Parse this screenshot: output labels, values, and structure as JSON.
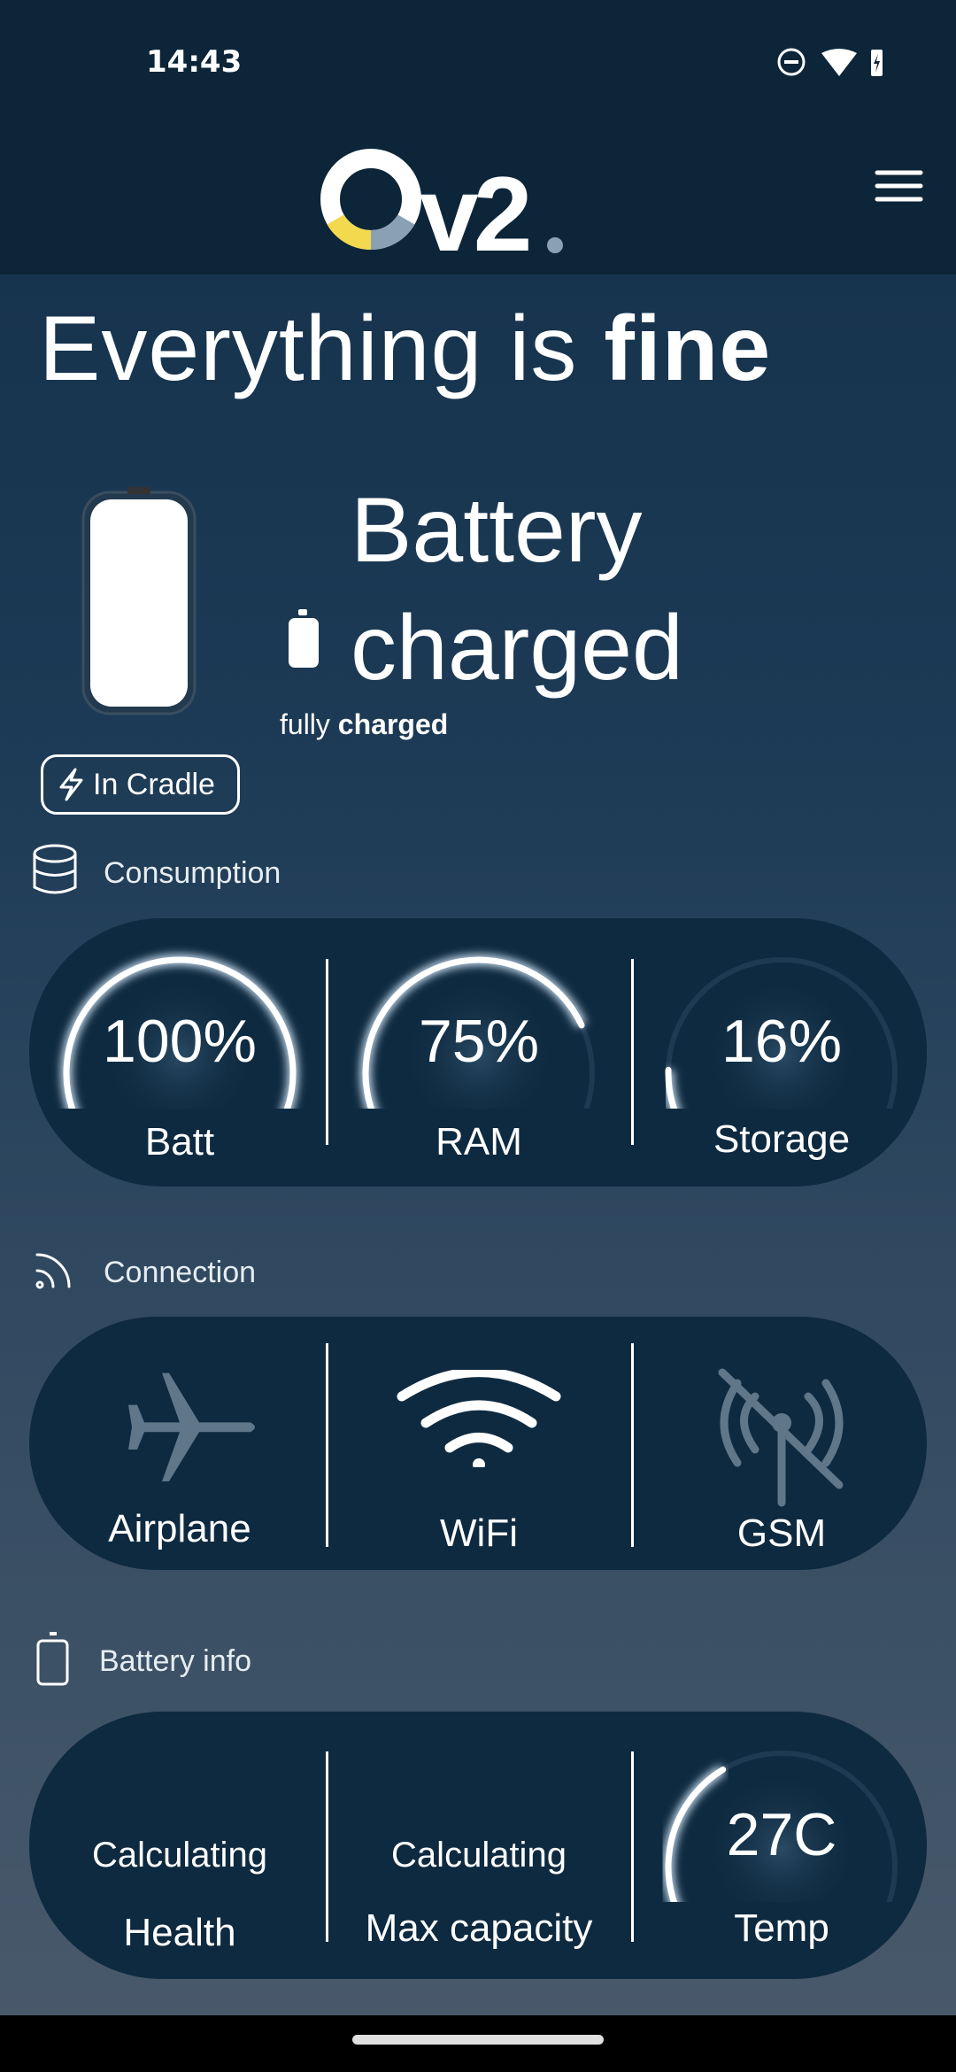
{
  "status_bar": {
    "time": "14:43",
    "icons": [
      "do-not-disturb-icon",
      "wifi-icon",
      "battery-charging-icon"
    ]
  },
  "header": {
    "logo": "Ov2.",
    "menu_icon": "hamburger-menu-icon",
    "logo_colors": {
      "yellow": "#f2d94e",
      "gray": "#8aa0b3"
    }
  },
  "hero": {
    "title_prefix": "Everything is ",
    "title_bold": "fine"
  },
  "battery": {
    "line1": "Battery",
    "line2": "charged",
    "sub_prefix": "fully ",
    "sub_bold": "charged",
    "cradle": "In Cradle"
  },
  "consumption": {
    "label": "Consumption",
    "gauges": [
      {
        "value": "100%",
        "label": "Batt",
        "percent": 100
      },
      {
        "value": "75%",
        "label": "RAM",
        "percent": 75
      },
      {
        "value": "16%",
        "label": "Storage",
        "percent": 16
      }
    ]
  },
  "connection": {
    "label": "Connection",
    "items": [
      {
        "label": "Airplane",
        "icon": "airplane-icon",
        "active": false
      },
      {
        "label": "WiFi",
        "icon": "wifi-icon",
        "active": true
      },
      {
        "label": "GSM",
        "icon": "cell-tower-off-icon",
        "active": false
      }
    ]
  },
  "battery_info": {
    "label": "Battery info",
    "health_value": "Calculating",
    "health_label": "Health",
    "capacity_value": "Calculating",
    "capacity_label": "Max capacity",
    "temp_value": "27C",
    "temp_label": "Temp"
  },
  "colors": {
    "card": "#0e2a40",
    "header": "#0d2538"
  }
}
